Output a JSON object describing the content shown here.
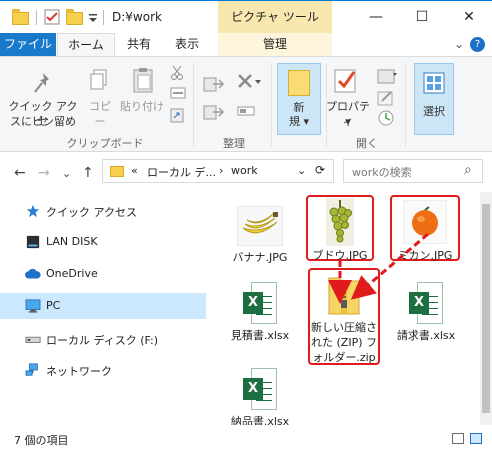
{
  "window": {
    "title": "D:¥work",
    "context_tab": "ピクチャ ツール",
    "controls": {
      "minimize": "—",
      "maximize": "☐",
      "close": "✕"
    }
  },
  "ribbon_tabs": [
    "ファイル",
    "ホーム",
    "共有",
    "表示",
    "管理"
  ],
  "ribbon_extra": {
    "expand": "⌄",
    "help": "?"
  },
  "ribbon": {
    "pin_label_1": "クイック アクセ",
    "pin_label_2": "スにピン留め",
    "copy": "コピー",
    "paste": "貼り付け",
    "group_clipboard": "クリップボード",
    "group_organize": "整理",
    "new_label_1": "新",
    "new_label_2": "規 ▾",
    "properties": "プロパティ",
    "properties_arrow": "▾",
    "group_open": "開く",
    "select": "選択"
  },
  "address": {
    "back": "←",
    "forward": "→",
    "recent": "⌄",
    "up": "↑",
    "crumb_overflow": "«",
    "crumb1": "ローカル デ...",
    "crumb_sep": "›",
    "crumb2": "work",
    "dropdown": "⌄",
    "refresh": "⟳",
    "search_placeholder": "workの検索",
    "search_icon": "⌕"
  },
  "nav_items": [
    {
      "label": "クイック アクセス",
      "icon": "star-icon"
    },
    {
      "label": "LAN DISK",
      "icon": "nas-icon"
    },
    {
      "label": "OneDrive",
      "icon": "cloud-icon"
    },
    {
      "label": "PC",
      "icon": "pc-icon"
    },
    {
      "label": "ローカル ディスク (F:)",
      "icon": "drive-icon"
    },
    {
      "label": "ネットワーク",
      "icon": "network-icon"
    }
  ],
  "files": [
    {
      "name": "バナナ.JPG",
      "type": "image"
    },
    {
      "name": "ブドウ.JPG",
      "type": "image"
    },
    {
      "name": "ミカン.JPG",
      "type": "image"
    },
    {
      "name": "見積書.xlsx",
      "type": "excel"
    },
    {
      "name": "新しい圧縮された (ZIP) フォルダー.zip",
      "type": "zip"
    },
    {
      "name": "請求書.xlsx",
      "type": "excel"
    },
    {
      "name": "納品書.xlsx",
      "type": "excel"
    }
  ],
  "file_lines": {
    "zip_1": "新しい圧縮さ",
    "zip_2": "れた (ZIP) フ",
    "zip_3": "ォルダー.zip"
  },
  "excel_badge": "X",
  "status": {
    "count": "7 個の項目"
  },
  "colors": {
    "accent": "#1979ca",
    "highlight": "#e01b1b",
    "selected": "#cce8ff"
  }
}
